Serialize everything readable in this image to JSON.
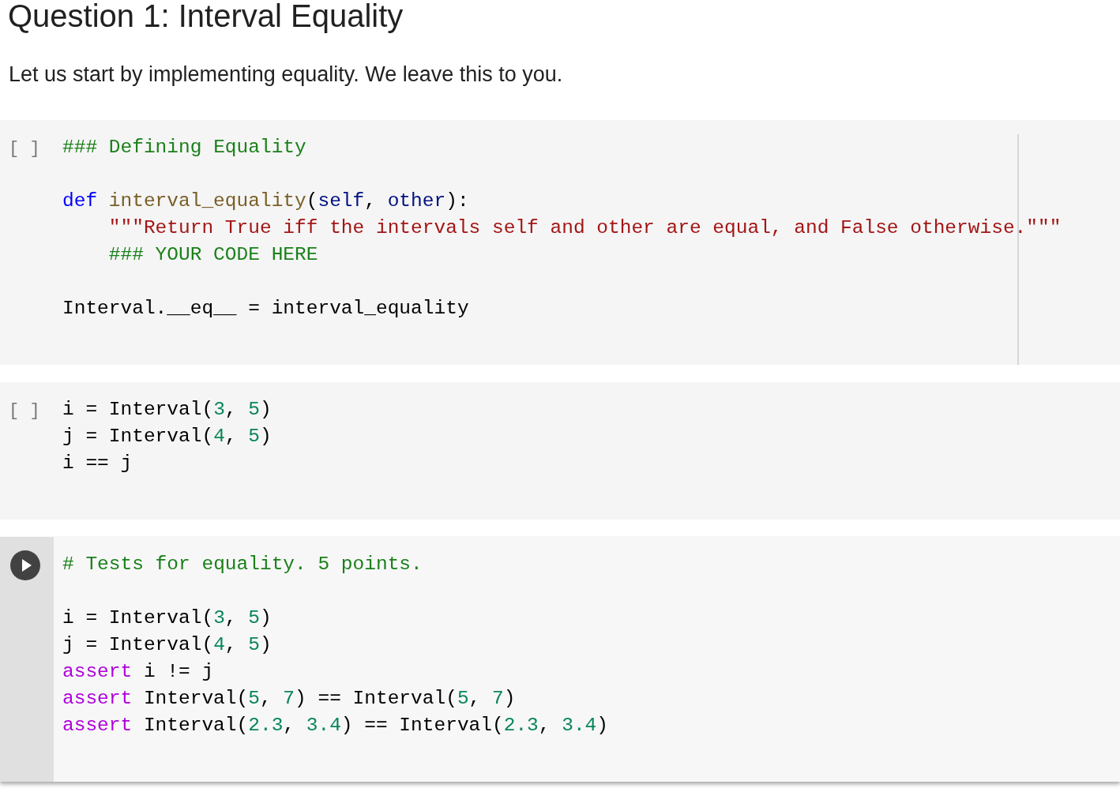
{
  "heading": "Question 1: Interval Equality",
  "intro": "Let us start by implementing equality. We leave this to you.",
  "cells": [
    {
      "focused": false,
      "prompt": "[ ]",
      "lines": [
        {
          "kind": "code",
          "indented": false,
          "tokens": [
            {
              "kind": "comment",
              "text": "### Defining Equality"
            }
          ]
        },
        {
          "kind": "blank"
        },
        {
          "kind": "code",
          "indented": false,
          "tokens": [
            {
              "kind": "keyword",
              "text": "def"
            },
            {
              "kind": "function",
              "text": "interval_equality"
            },
            {
              "kind": "plain",
              "text": "("
            },
            {
              "kind": "param",
              "text": "self"
            },
            {
              "kind": "plain",
              "text": ", "
            },
            {
              "kind": "param",
              "text": "other"
            },
            {
              "kind": "plain",
              "text": "):"
            }
          ]
        },
        {
          "kind": "code",
          "indented": true,
          "tokens": [
            {
              "kind": "string",
              "text": "\"\"\"Return True iff the intervals self and other are equal, and False otherwise.\"\"\""
            }
          ]
        },
        {
          "kind": "code",
          "indented": true,
          "tokens": [
            {
              "kind": "comment",
              "text": "### YOUR CODE HERE"
            }
          ]
        },
        {
          "kind": "blank"
        },
        {
          "kind": "code",
          "indented": false,
          "tokens": [
            {
              "kind": "plain",
              "text": "Interval.__eq__ = interval_equality"
            }
          ]
        }
      ]
    },
    {
      "focused": false,
      "prompt": "[ ]",
      "lines": [
        {
          "kind": "code",
          "indented": false,
          "tokens": [
            {
              "kind": "plain",
              "text": "i = Interval("
            },
            {
              "kind": "number",
              "text": "3"
            },
            {
              "kind": "plain",
              "text": ", "
            },
            {
              "kind": "number",
              "text": "5"
            },
            {
              "kind": "plain",
              "text": ")"
            }
          ]
        },
        {
          "kind": "code",
          "indented": false,
          "tokens": [
            {
              "kind": "plain",
              "text": "j = Interval("
            },
            {
              "kind": "number",
              "text": "4"
            },
            {
              "kind": "plain",
              "text": ", "
            },
            {
              "kind": "number",
              "text": "5"
            },
            {
              "kind": "plain",
              "text": ")"
            }
          ]
        },
        {
          "kind": "code",
          "indented": false,
          "tokens": [
            {
              "kind": "plain",
              "text": "i == j"
            }
          ]
        }
      ]
    },
    {
      "focused": true,
      "lines": [
        {
          "kind": "code",
          "indented": false,
          "tokens": [
            {
              "kind": "comment",
              "text": "# Tests for equality. 5 points."
            }
          ]
        },
        {
          "kind": "blank"
        },
        {
          "kind": "code",
          "indented": false,
          "tokens": [
            {
              "kind": "plain",
              "text": "i = Interval("
            },
            {
              "kind": "number",
              "text": "3"
            },
            {
              "kind": "plain",
              "text": ", "
            },
            {
              "kind": "number",
              "text": "5"
            },
            {
              "kind": "plain",
              "text": ")"
            }
          ]
        },
        {
          "kind": "code",
          "indented": false,
          "tokens": [
            {
              "kind": "plain",
              "text": "j = Interval("
            },
            {
              "kind": "number",
              "text": "4"
            },
            {
              "kind": "plain",
              "text": ", "
            },
            {
              "kind": "number",
              "text": "5"
            },
            {
              "kind": "plain",
              "text": ")"
            }
          ]
        },
        {
          "kind": "code",
          "indented": false,
          "tokens": [
            {
              "kind": "control",
              "text": "assert"
            },
            {
              "kind": "plain",
              "text": "i != j"
            }
          ]
        },
        {
          "kind": "code",
          "indented": false,
          "tokens": [
            {
              "kind": "control",
              "text": "assert"
            },
            {
              "kind": "plain",
              "text": "Interval("
            },
            {
              "kind": "number",
              "text": "5"
            },
            {
              "kind": "plain",
              "text": ", "
            },
            {
              "kind": "number",
              "text": "7"
            },
            {
              "kind": "plain",
              "text": ") == Interval("
            },
            {
              "kind": "number",
              "text": "5"
            },
            {
              "kind": "plain",
              "text": ", "
            },
            {
              "kind": "number",
              "text": "7"
            },
            {
              "kind": "plain",
              "text": ")"
            }
          ]
        },
        {
          "kind": "code",
          "indented": false,
          "tokens": [
            {
              "kind": "control",
              "text": "assert"
            },
            {
              "kind": "plain",
              "text": "Interval("
            },
            {
              "kind": "number",
              "text": "2.3"
            },
            {
              "kind": "plain",
              "text": ", "
            },
            {
              "kind": "number",
              "text": "3.4"
            },
            {
              "kind": "plain",
              "text": ") == Interval("
            },
            {
              "kind": "number",
              "text": "2.3"
            },
            {
              "kind": "plain",
              "text": ", "
            },
            {
              "kind": "number",
              "text": "3.4"
            },
            {
              "kind": "plain",
              "text": ")"
            }
          ]
        }
      ]
    }
  ]
}
